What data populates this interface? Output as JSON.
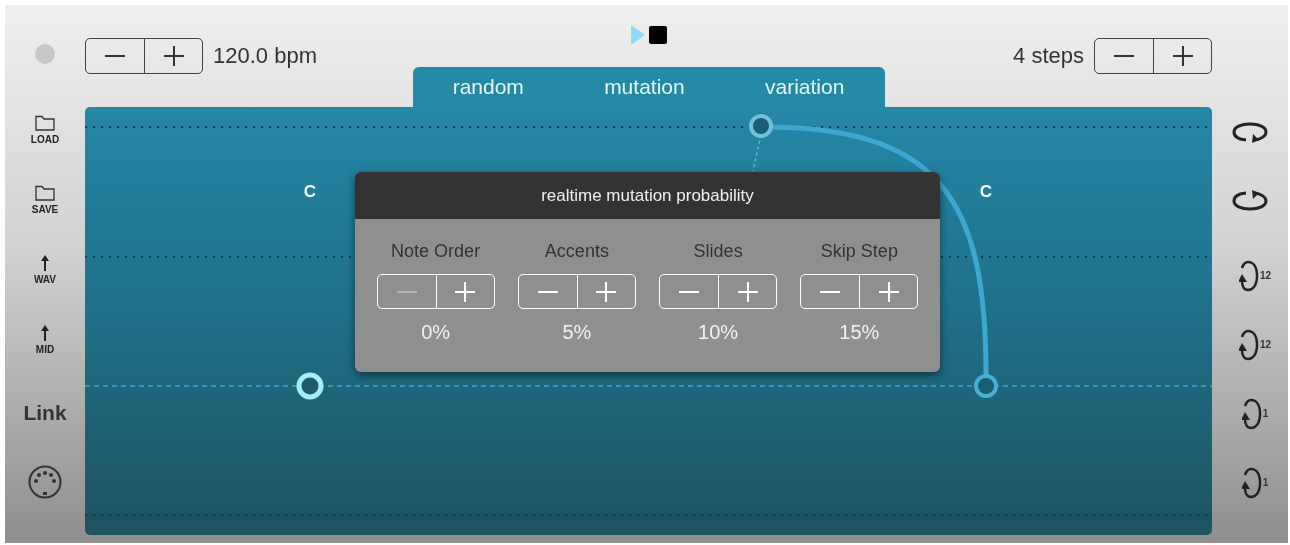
{
  "tempo": {
    "value": "120.0 bpm"
  },
  "steps": {
    "value": "4 steps"
  },
  "tabs": [
    {
      "label": "random"
    },
    {
      "label": "mutation"
    },
    {
      "label": "variation"
    }
  ],
  "left_sidebar": [
    {
      "kind": "folder",
      "label": "LOAD"
    },
    {
      "kind": "folder",
      "label": "SAVE"
    },
    {
      "kind": "upload",
      "label": "WAV"
    },
    {
      "kind": "upload",
      "label": "MID"
    },
    {
      "kind": "text",
      "label": "Link"
    },
    {
      "kind": "midi"
    }
  ],
  "right_sidebar": [
    {
      "kind": "loop-left"
    },
    {
      "kind": "loop-right"
    },
    {
      "kind": "rotate",
      "badge": "12"
    },
    {
      "kind": "rotate",
      "badge": "12"
    },
    {
      "kind": "rotate",
      "badge": "1"
    },
    {
      "kind": "rotate",
      "badge": "1"
    }
  ],
  "canvas": {
    "note_labels": [
      "C",
      "C"
    ]
  },
  "popup": {
    "title": "realtime mutation probability",
    "parameters": [
      {
        "label": "Note Order",
        "value": "0%",
        "minus_disabled": true
      },
      {
        "label": "Accents",
        "value": "5%",
        "minus_disabled": false
      },
      {
        "label": "Slides",
        "value": "10%",
        "minus_disabled": false
      },
      {
        "label": "Skip Step",
        "value": "15%",
        "minus_disabled": false
      }
    ]
  }
}
